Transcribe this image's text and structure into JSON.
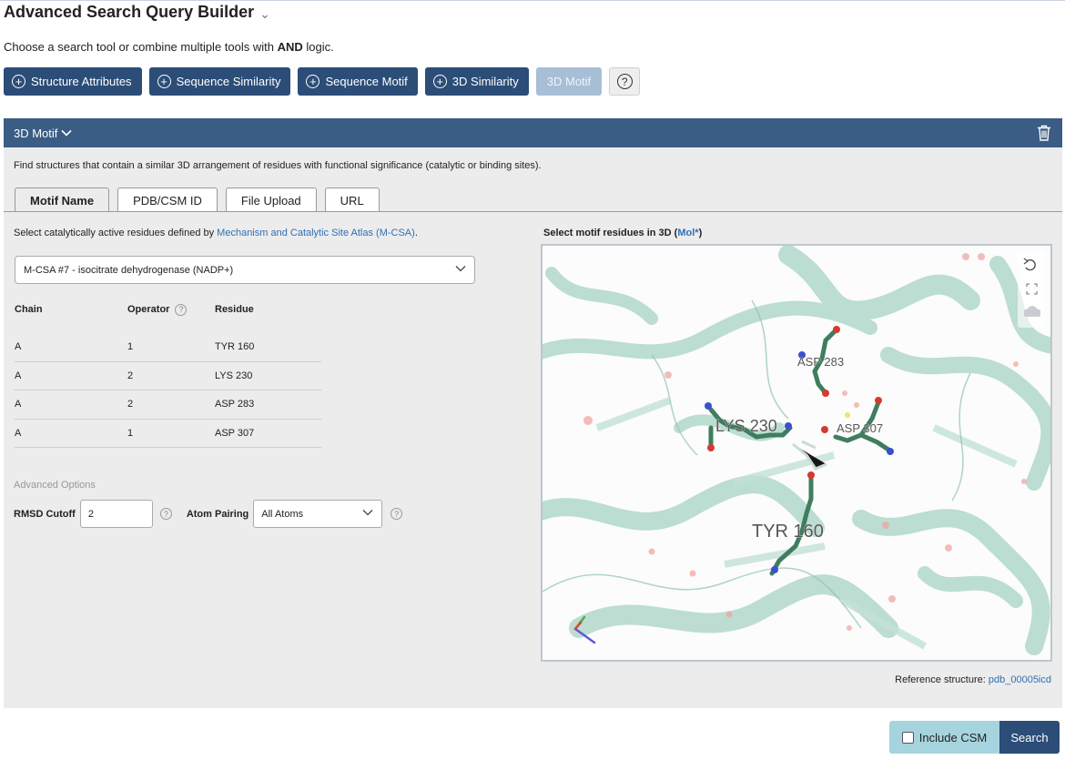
{
  "header": {
    "title": "Advanced Search Query Builder",
    "subtitle_prefix": "Choose a search tool or combine multiple tools with ",
    "subtitle_bold": "AND",
    "subtitle_suffix": " logic."
  },
  "toolbar": {
    "buttons": [
      {
        "label": "Structure Attributes"
      },
      {
        "label": "Sequence Similarity"
      },
      {
        "label": "Sequence Motif"
      },
      {
        "label": "3D Similarity"
      }
    ],
    "disabled_label": "3D Motif",
    "help_symbol": "?"
  },
  "panel": {
    "title": "3D Motif",
    "description": "Find structures that contain a similar 3D arrangement of residues with functional significance (catalytic or binding sites).",
    "tabs": [
      {
        "label": "Motif Name",
        "active": true
      },
      {
        "label": "PDB/CSM ID",
        "active": false
      },
      {
        "label": "File Upload",
        "active": false
      },
      {
        "label": "URL",
        "active": false
      }
    ],
    "select_prefix": "Select catalytically active residues defined by ",
    "select_link": "Mechanism and Catalytic Site Atlas (M-CSA)",
    "select_suffix": ".",
    "dropdown_value": "M-CSA #7 - isocitrate dehydrogenase (NADP+)",
    "table": {
      "headers": [
        "Chain",
        "Operator",
        "Residue"
      ],
      "rows": [
        {
          "chain": "A",
          "operator": "1",
          "residue": "TYR 160"
        },
        {
          "chain": "A",
          "operator": "2",
          "residue": "LYS 230"
        },
        {
          "chain": "A",
          "operator": "2",
          "residue": "ASP 283"
        },
        {
          "chain": "A",
          "operator": "1",
          "residue": "ASP 307"
        }
      ]
    },
    "advanced": {
      "label": "Advanced Options",
      "rmsd_label": "RMSD Cutoff",
      "rmsd_value": "2",
      "atom_label": "Atom Pairing",
      "atom_value": "All Atoms"
    },
    "viewer": {
      "label_prefix": "Select motif residues in 3D (",
      "label_link": "Mol*",
      "label_suffix": ")",
      "residue_labels": [
        "ASP 283",
        "LYS 230",
        "ASP 307",
        "TYR 160"
      ]
    },
    "reference_prefix": "Reference structure: ",
    "reference_link": "pdb_00005icd"
  },
  "footer": {
    "include_csm": "Include CSM",
    "search": "Search"
  },
  "colors": {
    "primary": "#2b4d77",
    "panel_header": "#3a5c85",
    "disabled": "#a7bfd6",
    "link": "#2f6fb5",
    "csm_bg": "#a6d4de",
    "ribbon": "#9fcfbf",
    "stick": "#3f7d5e"
  }
}
